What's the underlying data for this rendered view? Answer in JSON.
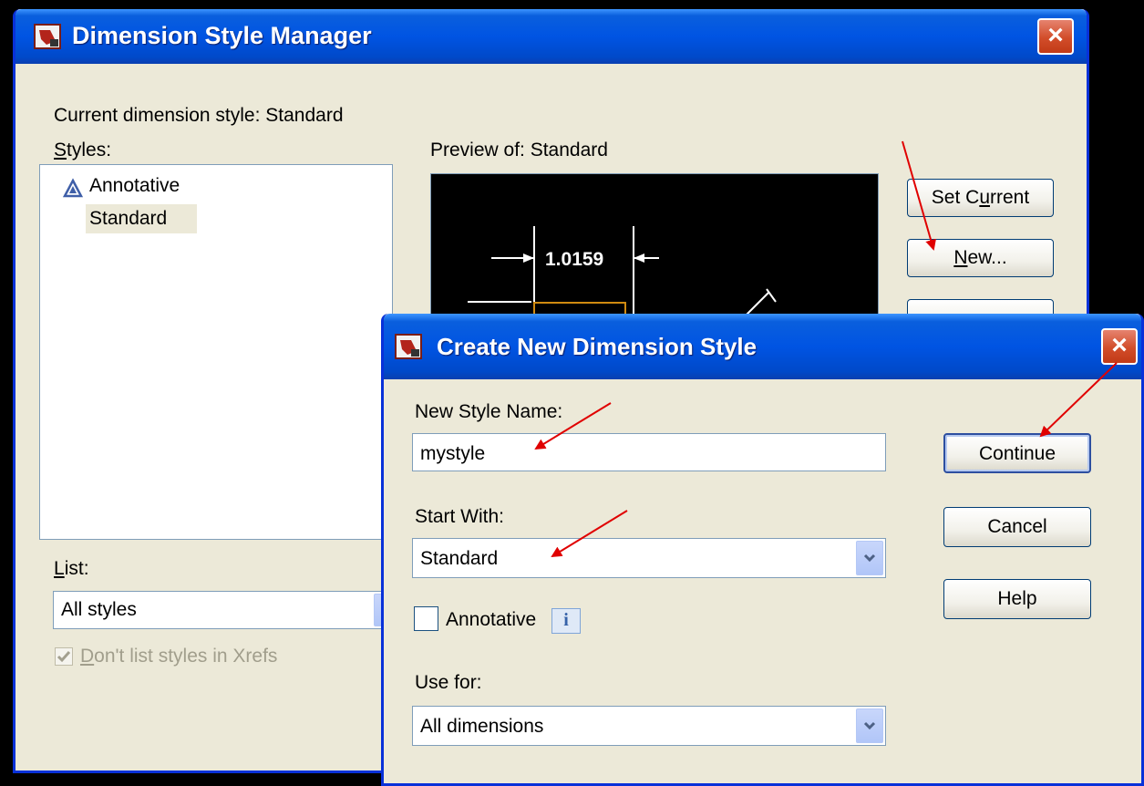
{
  "main_dialog": {
    "title": "Dimension Style Manager",
    "close_label": "×",
    "current_style_text": "Current dimension style: Standard",
    "styles_label_first": "S",
    "styles_label_rest": "tyles:",
    "styles": [
      "Annotative",
      "Standard"
    ],
    "preview_label": "Preview of: Standard",
    "preview_dimension": "1.0159",
    "list_label_first": "L",
    "list_label_rest": "ist:",
    "list_value": "All styles",
    "xrefs_checkbox_first": "D",
    "xrefs_checkbox_rest": "on't list styles in Xrefs",
    "xrefs_checked": true,
    "set_current_a": "Set C",
    "set_current_u": "u",
    "set_current_b": "rrent",
    "new_u": "N",
    "new_rest": "ew..."
  },
  "create_dialog": {
    "title": "Create New Dimension Style",
    "close_label": "×",
    "new_style_name_label": "New Style Name:",
    "new_style_name_value": "mystyle",
    "start_with_label": "Start With:",
    "start_with_value": "Standard",
    "annotative_label": "Annotative",
    "annotative_checked": false,
    "info_icon_text": "i",
    "use_for_label": "Use for:",
    "use_for_value": "All dimensions",
    "continue_label": "Continue",
    "cancel_label": "Cancel",
    "help_label": "Help"
  },
  "colors": {
    "titlebar_blue": "#0054e3",
    "dialog_bg": "#ece9d8",
    "annotation_arrow": "#e00000",
    "preview_bg": "#000000",
    "preview_dim_box": "#d08a10"
  }
}
